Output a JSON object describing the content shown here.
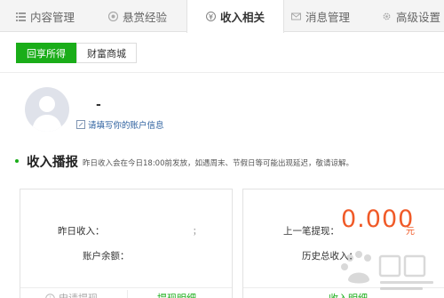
{
  "tabs": [
    {
      "label": "内容管理",
      "icon": "list-icon"
    },
    {
      "label": "悬赏经验",
      "icon": "coin-icon"
    },
    {
      "label": "收入相关",
      "icon": "money-icon"
    },
    {
      "label": "消息管理",
      "icon": "mail-icon"
    },
    {
      "label": "高级设置",
      "icon": "gear-icon"
    }
  ],
  "subtabs": [
    {
      "label": "回享所得"
    },
    {
      "label": "财富商城"
    }
  ],
  "profile": {
    "nickname": "-",
    "edit_link": "请填写你的账户信息"
  },
  "section": {
    "title": "收入播报",
    "note": "昨日收入会在今日18:00前发放，如遇周末、节假日等可能出现延迟，敬请谅解。"
  },
  "left_card": {
    "yesterday_label": "昨日收入：",
    "yesterday_value": "",
    "balance_label": "账户余额：",
    "mark": "；",
    "apply_label": "申请提现",
    "detail_label": "提现明细"
  },
  "right_card": {
    "last_label": "上一笔提现：",
    "last_value": "0.000",
    "last_unit": "元",
    "total_label": "历史总收入：",
    "detail_label": "收入明细"
  },
  "colors": {
    "accent": "#1aad19",
    "amount": "#f05a28",
    "link": "#2b5f9e"
  }
}
